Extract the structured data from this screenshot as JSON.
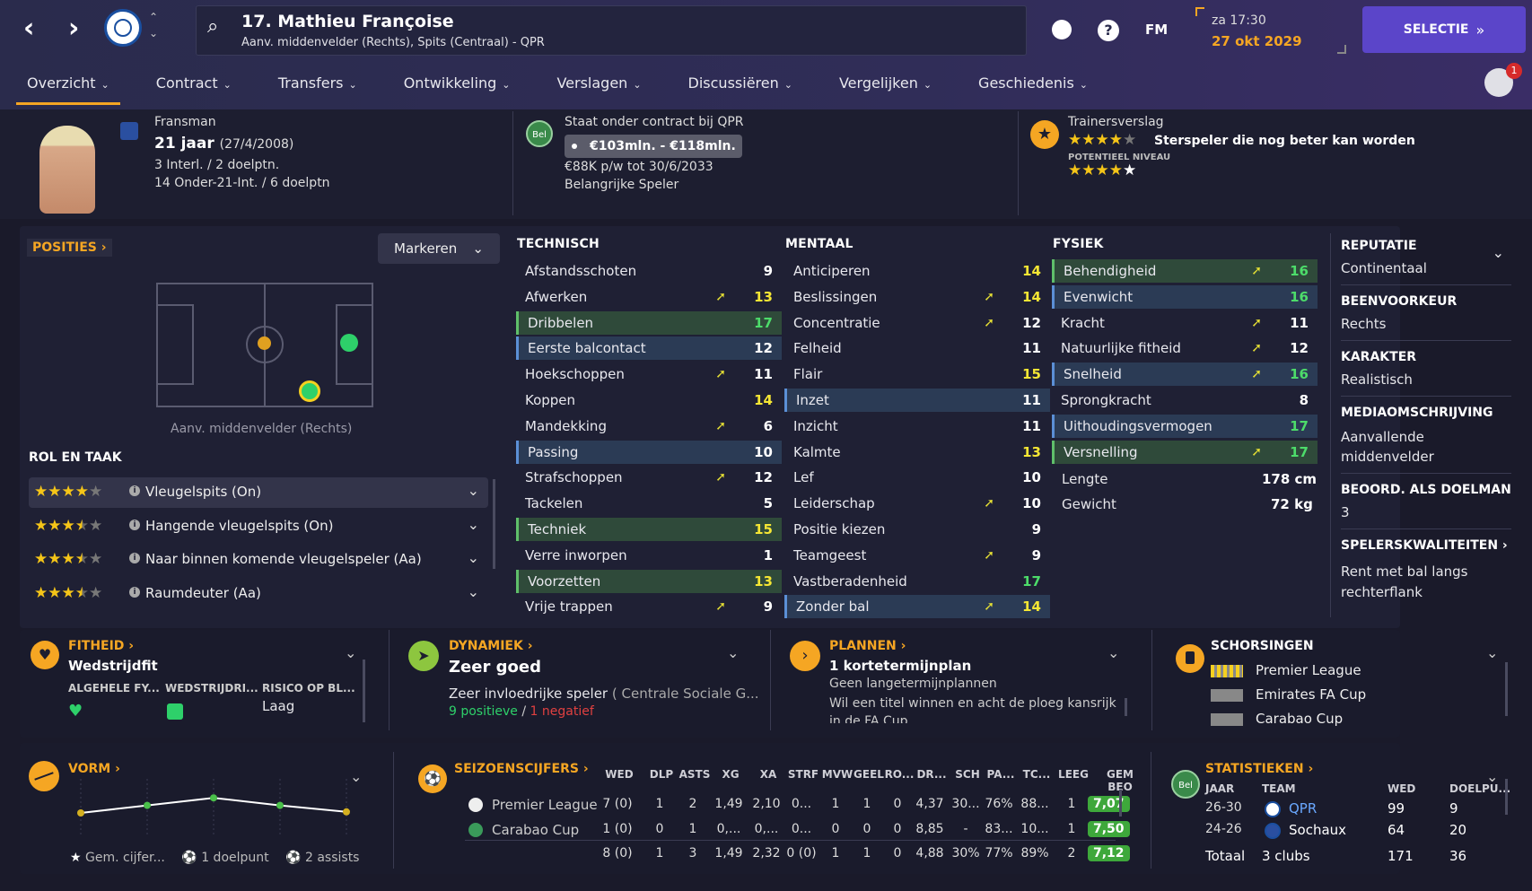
{
  "header": {
    "player_title": "17. Mathieu Françoise",
    "player_subtitle": "Aanv. middenvelder (Rechts), Spits (Centraal) - QPR",
    "time": "za 17:30",
    "date": "27 okt 2029",
    "fm_label": "FM",
    "selection_button": "SELECTIE",
    "notification_count": "1"
  },
  "tabs": [
    "Overzicht",
    "Contract",
    "Transfers",
    "Ontwikkeling",
    "Verslagen",
    "Discussiëren",
    "Vergelijken",
    "Geschiedenis"
  ],
  "profile": {
    "nationality": "Fransman",
    "age": "21 jaar",
    "dob": "(27/4/2008)",
    "caps": "3 Interl. / 2 doelptn.",
    "u21": "14 Onder-21-Int. / 6 doelptn"
  },
  "contract": {
    "badge": "Bel",
    "status": "Staat onder contract bij QPR",
    "value": "€103mln. - €118mln.",
    "wage": "€88K p/w tot 30/6/2033",
    "role": "Belangrijke Speler"
  },
  "scout": {
    "title": "Trainersverslag",
    "summary": "Sterspeler die nog beter kan worden",
    "potential_label": "POTENTIEEL NIVEAU",
    "current_stars": 4,
    "potential_stars": 4.5
  },
  "positions": {
    "title": "POSITIES",
    "mark_button": "Markeren",
    "position_label": "Aanv. middenvelder (Rechts)"
  },
  "roles": {
    "title": "ROL EN TAAK",
    "items": [
      {
        "name": "Vleugelspits (On)",
        "stars": 4
      },
      {
        "name": "Hangende vleugelspits (On)",
        "stars": 3.5
      },
      {
        "name": "Naar binnen komende vleugelspeler (Aa)",
        "stars": 3.5
      },
      {
        "name": "Raumdeuter (Aa)",
        "stars": 3.5
      }
    ]
  },
  "technical": {
    "title": "TECHNISCH",
    "items": [
      {
        "name": "Afstandsschoten",
        "value": "9"
      },
      {
        "name": "Afwerken",
        "value": "13"
      },
      {
        "name": "Dribbelen",
        "value": "17"
      },
      {
        "name": "Eerste balcontact",
        "value": "12"
      },
      {
        "name": "Hoekschoppen",
        "value": "11"
      },
      {
        "name": "Koppen",
        "value": "14"
      },
      {
        "name": "Mandekking",
        "value": "6"
      },
      {
        "name": "Passing",
        "value": "10"
      },
      {
        "name": "Strafschoppen",
        "value": "12"
      },
      {
        "name": "Tackelen",
        "value": "5"
      },
      {
        "name": "Techniek",
        "value": "15"
      },
      {
        "name": "Verre inworpen",
        "value": "1"
      },
      {
        "name": "Voorzetten",
        "value": "13"
      },
      {
        "name": "Vrije trappen",
        "value": "9"
      }
    ]
  },
  "mental": {
    "title": "MENTAAL",
    "items": [
      {
        "name": "Anticiperen",
        "value": "14"
      },
      {
        "name": "Beslissingen",
        "value": "14"
      },
      {
        "name": "Concentratie",
        "value": "12"
      },
      {
        "name": "Felheid",
        "value": "11"
      },
      {
        "name": "Flair",
        "value": "15"
      },
      {
        "name": "Inzet",
        "value": "11"
      },
      {
        "name": "Inzicht",
        "value": "11"
      },
      {
        "name": "Kalmte",
        "value": "13"
      },
      {
        "name": "Lef",
        "value": "10"
      },
      {
        "name": "Leiderschap",
        "value": "10"
      },
      {
        "name": "Positie kiezen",
        "value": "9"
      },
      {
        "name": "Teamgeest",
        "value": "9"
      },
      {
        "name": "Vastberadenheid",
        "value": "17"
      },
      {
        "name": "Zonder bal",
        "value": "14"
      }
    ]
  },
  "physical": {
    "title": "FYSIEK",
    "items": [
      {
        "name": "Behendigheid",
        "value": "16"
      },
      {
        "name": "Evenwicht",
        "value": "16"
      },
      {
        "name": "Kracht",
        "value": "11"
      },
      {
        "name": "Natuurlijke fitheid",
        "value": "12"
      },
      {
        "name": "Snelheid",
        "value": "16"
      },
      {
        "name": "Sprongkracht",
        "value": "8"
      },
      {
        "name": "Uithoudingsvermogen",
        "value": "17"
      },
      {
        "name": "Versnelling",
        "value": "17"
      }
    ],
    "height_label": "Lengte",
    "height": "178 cm",
    "weight_label": "Gewicht",
    "weight": "72 kg"
  },
  "info": {
    "reputation_label": "REPUTATIE",
    "reputation": "Continentaal",
    "foot_label": "BEENVOORKEUR",
    "foot": "Rechts",
    "character_label": "KARAKTER",
    "character": "Realistisch",
    "media_label": "MEDIAOMSCHRIJVING",
    "media": "Aanvallende middenvelder",
    "gk_label": "BEOORD. ALS DOELMAN",
    "gk": "3",
    "traits_label": "SPELERSKWALITEITEN",
    "traits": "Rent met bal langs rechterflank"
  },
  "fitness": {
    "title": "FITHEID",
    "status": "Wedstrijdfit",
    "c1": "ALGEHELE FY...",
    "c2": "WEDSTRIJDRI...",
    "c3": "RISICO OP BL...",
    "risk": "Laag"
  },
  "dynamics": {
    "title": "DYNAMIEK",
    "status": "Zeer goed",
    "desc": "Zeer invloedrijke speler",
    "group": "( Centrale Sociale G...",
    "positive": "9 positieve",
    "sep": "/",
    "negative": "1 negatief"
  },
  "plans": {
    "title": "PLANNEN",
    "short": "1 kortetermijnplan",
    "long": "Geen langetermijnplannen",
    "desc": "Wil een titel winnen en acht de ploeg kansrijk in de FA Cup"
  },
  "suspensions": {
    "title": "SCHORSINGEN",
    "items": [
      "Premier League",
      "Emirates FA Cup",
      "Carabao Cup"
    ]
  },
  "form": {
    "title": "VORM",
    "avg_label": "Gem. cijfer...",
    "goals": "1 doelpunt",
    "assists": "2 assists",
    "points": [
      5.5,
      6.2,
      6.9,
      6.2,
      5.6
    ]
  },
  "season": {
    "title": "SEIZOENSCIJFERS",
    "headers": [
      "WED",
      "DLP",
      "ASTS",
      "XG",
      "XA",
      "STRF",
      "MVW",
      "GEEL",
      "RO...",
      "DR...",
      "SCH",
      "PA...",
      "TC...",
      "LEEG",
      "GEM BEO"
    ],
    "rows": [
      {
        "comp": "Premier League",
        "cells": [
          "7 (0)",
          "1",
          "2",
          "1,49",
          "2,10",
          "0...",
          "1",
          "1",
          "0",
          "4,37",
          "30...",
          "76%",
          "88...",
          "1"
        ],
        "rating": "7,07"
      },
      {
        "comp": "Carabao Cup",
        "cells": [
          "1 (0)",
          "0",
          "1",
          "0,...",
          "0,...",
          "0...",
          "0",
          "0",
          "0",
          "8,85",
          "-",
          "83...",
          "10...",
          "1"
        ],
        "rating": "7,50"
      }
    ],
    "total": {
      "cells": [
        "8 (0)",
        "1",
        "3",
        "1,49",
        "2,32",
        "0 (0)",
        "1",
        "1",
        "0",
        "4,88",
        "30%",
        "77%",
        "89%",
        "2"
      ],
      "rating": "7,12"
    }
  },
  "stats": {
    "title": "STATISTIEKEN",
    "badge": "Bel",
    "headers": [
      "JAAR",
      "TEAM",
      "WED",
      "DOELPU..."
    ],
    "rows": [
      {
        "year": "26-30",
        "team": "QPR",
        "apps": "99",
        "goals": "9"
      },
      {
        "year": "24-26",
        "team": "Sochaux",
        "apps": "64",
        "goals": "20"
      }
    ],
    "total_label": "Totaal",
    "total_team": "3 clubs",
    "total_apps": "171",
    "total_goals": "36"
  }
}
